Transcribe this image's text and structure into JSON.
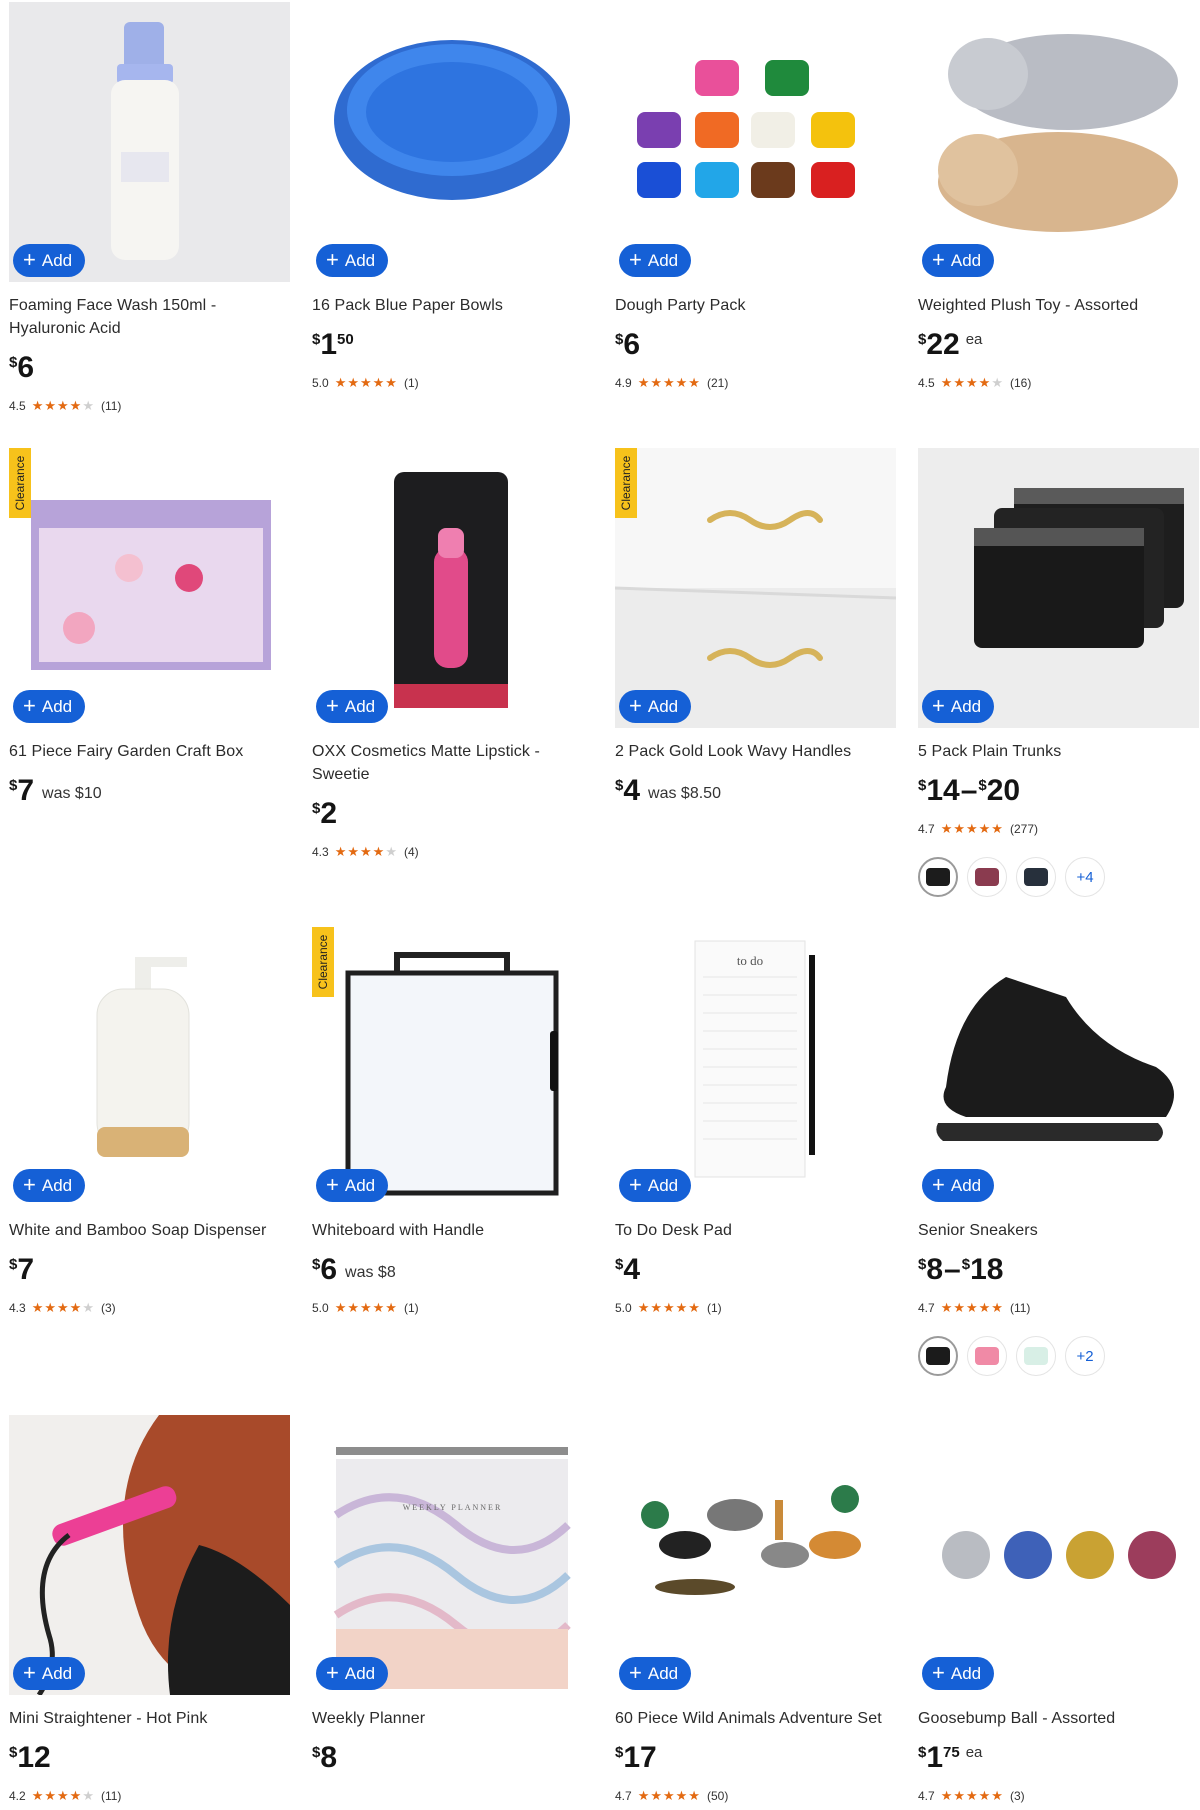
{
  "add_label": "Add",
  "clearance_label": "Clearance",
  "products": [
    {
      "title": "Foaming Face Wash 150ml - Hyaluronic Acid",
      "price": "6",
      "rating": "4.5",
      "reviews": "(11)"
    },
    {
      "title": "16 Pack Blue Paper Bowls",
      "price": "1",
      "cents": "50",
      "rating": "5.0",
      "reviews": "(1)"
    },
    {
      "title": "Dough Party Pack",
      "price": "6",
      "rating": "4.9",
      "reviews": "(21)"
    },
    {
      "title": "Weighted Plush Toy - Assorted",
      "price": "22",
      "unit": "ea",
      "rating": "4.5",
      "reviews": "(16)"
    },
    {
      "title": "61 Piece Fairy Garden Craft Box",
      "price": "7",
      "was": "was $10",
      "clearance": true
    },
    {
      "title": "OXX Cosmetics Matte Lipstick - Sweetie",
      "price": "2",
      "rating": "4.3",
      "reviews": "(4)"
    },
    {
      "title": "2 Pack Gold Look Wavy Handles",
      "price": "4",
      "was": "was $8.50",
      "clearance": true
    },
    {
      "title": "5 Pack Plain Trunks",
      "price_from": "14",
      "price_to": "20",
      "rating": "4.7",
      "reviews": "(277)",
      "more_swatches": "+4"
    },
    {
      "title": "White and Bamboo Soap Dispenser",
      "price": "7",
      "rating": "4.3",
      "reviews": "(3)"
    },
    {
      "title": "Whiteboard with Handle",
      "price": "6",
      "was": "was $8",
      "rating": "5.0",
      "reviews": "(1)",
      "clearance": true
    },
    {
      "title": "To Do Desk Pad",
      "price": "4",
      "rating": "5.0",
      "reviews": "(1)",
      "pad_text": "to do"
    },
    {
      "title": "Senior Sneakers",
      "price_from": "8",
      "price_to": "18",
      "rating": "4.7",
      "reviews": "(11)",
      "more_swatches": "+2"
    },
    {
      "title": "Mini Straightener - Hot Pink",
      "price": "12",
      "rating": "4.2",
      "reviews": "(11)"
    },
    {
      "title": "Weekly Planner",
      "price": "8",
      "planner_text": "WEEKLY PLANNER"
    },
    {
      "title": "60 Piece Wild Animals Adventure Set",
      "price": "17",
      "rating": "4.7",
      "reviews": "(50)"
    },
    {
      "title": "Goosebump Ball - Assorted",
      "price": "1",
      "cents": "75",
      "unit": "ea",
      "rating": "4.7",
      "reviews": "(3)"
    }
  ],
  "colors": {
    "accent": "#1560d6",
    "star": "#e36a12",
    "clearance": "#f7c21b"
  },
  "icons": [
    "plus-icon",
    "star-icon"
  ]
}
